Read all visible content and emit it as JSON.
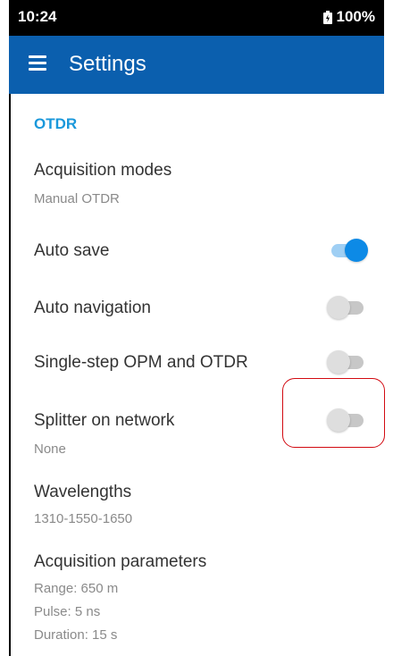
{
  "status_bar": {
    "time": "10:24",
    "battery": "100%"
  },
  "app_bar": {
    "menu_icon": "hamburger-menu-icon",
    "title": "Settings"
  },
  "section": {
    "title": "OTDR"
  },
  "settings": {
    "acquisition_modes": {
      "title": "Acquisition modes",
      "value": "Manual OTDR"
    },
    "auto_save": {
      "title": "Auto save",
      "enabled": true
    },
    "auto_navigation": {
      "title": "Auto navigation",
      "enabled": false
    },
    "single_step": {
      "title": "Single-step OPM and OTDR",
      "enabled": false
    },
    "splitter": {
      "title": "Splitter on network",
      "value": "None",
      "enabled": false
    },
    "wavelengths": {
      "title": "Wavelengths",
      "value": "1310-1550-1650"
    },
    "acquisition_parameters": {
      "title": "Acquisition parameters",
      "range": "Range: 650 m",
      "pulse": "Pulse: 5 ns",
      "duration": "Duration: 15 s"
    }
  },
  "colors": {
    "app_bar": "#0b5fae",
    "section_header": "#1a98db",
    "toggle_on": "#0d8ae6",
    "highlight": "#d20a11"
  }
}
